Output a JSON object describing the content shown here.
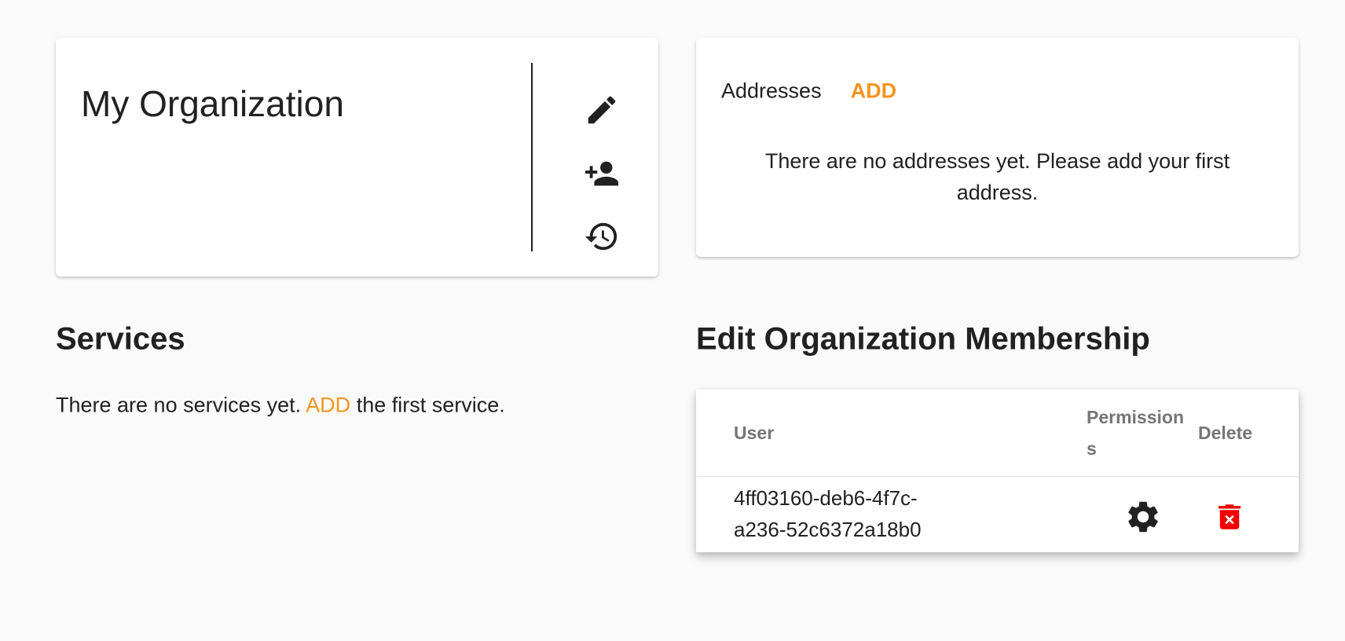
{
  "organization": {
    "name": "My Organization",
    "actions": {
      "edit_icon": "pencil-icon",
      "add_member_icon": "person-add-icon",
      "history_icon": "history-icon"
    }
  },
  "addresses": {
    "label": "Addresses",
    "add_label": "ADD",
    "empty_message": "There are no addresses yet. Please add your first address."
  },
  "services": {
    "title": "Services",
    "empty_prefix": "There are no services yet.",
    "add_label": "ADD",
    "empty_suffix": "the first service."
  },
  "membership": {
    "title": "Edit Organization Membership",
    "columns": {
      "user": "User",
      "permissions": "Permissions",
      "delete": "Delete"
    },
    "rows": [
      {
        "user": "4ff03160-deb6-4f7c-a236-52c6372a18b0",
        "permissions_icon": "gear-icon",
        "delete_icon": "trash-icon"
      }
    ]
  },
  "colors": {
    "accent": "#f7931e",
    "danger": "#f20000",
    "text": "#212121",
    "muted": "#757575",
    "background": "#fafafa"
  }
}
